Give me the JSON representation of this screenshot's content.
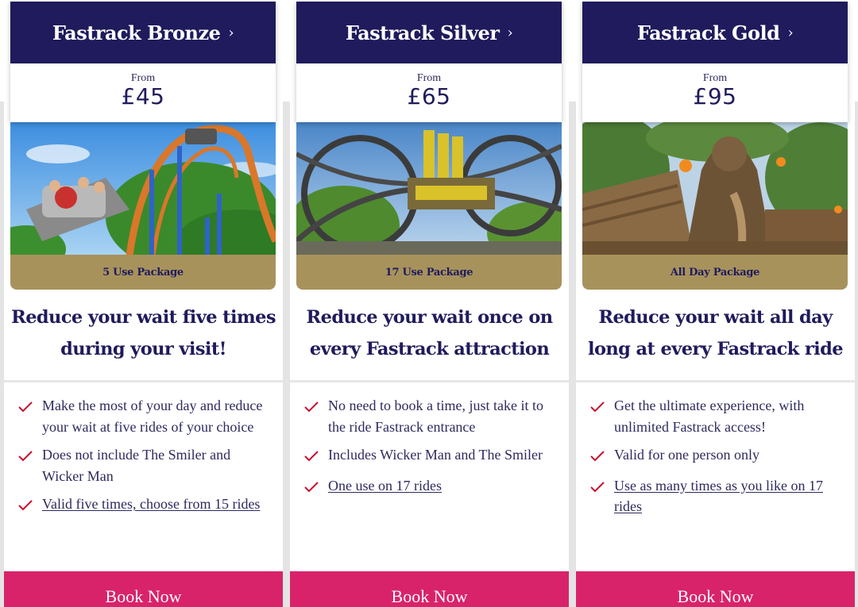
{
  "colors": {
    "navy": "#1f1b5c",
    "gold": "#a8925c",
    "pink": "#d8236a",
    "tick_red": "#c8102e",
    "background_grey": "#e4e4e4"
  },
  "cards": [
    {
      "title": "Fastrack Bronze",
      "chevron": "›",
      "from_label": "From",
      "price": "£45",
      "image_alt": "rollercoaster-ride-photo",
      "package": "5 Use Package",
      "headline": "Reduce your wait five times during your visit!",
      "features": [
        {
          "text": "Make the most of your day and reduce your wait at five rides of your choice",
          "link": false
        },
        {
          "text": "Does not include The Smiler and Wicker Man",
          "link": false
        },
        {
          "text": "Valid five times, choose from 15 rides",
          "link": true
        }
      ],
      "button": "Book Now"
    },
    {
      "title": "Fastrack Silver",
      "chevron": "›",
      "from_label": "From",
      "price": "£65",
      "image_alt": "smiler-rollercoaster-photo",
      "package": "17 Use Package",
      "headline": "Reduce your wait once on every Fastrack attraction",
      "features": [
        {
          "text": "No need to book a time, just take it to the ride Fastrack entrance",
          "link": false
        },
        {
          "text": "Includes Wicker Man and The Smiler",
          "link": false
        },
        {
          "text": "One use on 17 rides",
          "link": true
        }
      ],
      "button": "Book Now"
    },
    {
      "title": "Fastrack Gold",
      "chevron": "›",
      "from_label": "From",
      "price": "£95",
      "image_alt": "wicker-man-ride-photo",
      "package": "All Day Package",
      "headline": "Reduce your wait all day long at every Fastrack ride",
      "features": [
        {
          "text": "Get the ultimate experience, with unlimited Fastrack access!",
          "link": false
        },
        {
          "text": "Valid for one person only",
          "link": false
        },
        {
          "text": "Use as many times as you like on 17 rides",
          "link": true
        }
      ],
      "button": "Book Now"
    }
  ]
}
